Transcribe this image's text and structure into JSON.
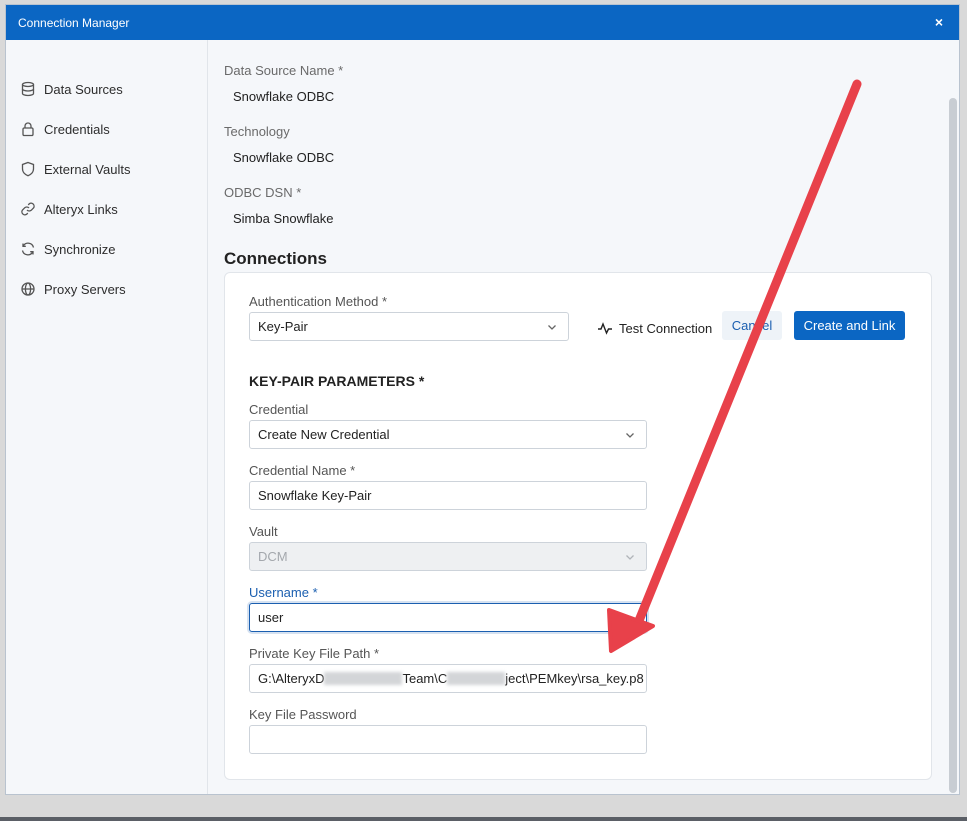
{
  "window": {
    "title": "Connection Manager",
    "close_glyph": "×"
  },
  "sidebar": {
    "items": [
      {
        "label": "Data Sources",
        "icon": "database-icon"
      },
      {
        "label": "Credentials",
        "icon": "lock-icon"
      },
      {
        "label": "External Vaults",
        "icon": "shield-icon"
      },
      {
        "label": "Alteryx Links",
        "icon": "link-icon"
      },
      {
        "label": "Synchronize",
        "icon": "sync-icon"
      },
      {
        "label": "Proxy Servers",
        "icon": "globe-icon"
      }
    ]
  },
  "details": {
    "data_source_name_label": "Data Source Name *",
    "data_source_name": "Snowflake ODBC",
    "technology_label": "Technology",
    "technology": "Snowflake ODBC",
    "odbc_dsn_label": "ODBC DSN *",
    "odbc_dsn": "Simba Snowflake"
  },
  "connections": {
    "title": "Connections",
    "auth_method_label": "Authentication Method *",
    "auth_method_value": "Key-Pair",
    "test_connection_label": "Test Connection",
    "cancel_label": "Cancel",
    "create_link_label": "Create and Link",
    "keypair_title": "KEY-PAIR PARAMETERS *",
    "credential_label": "Credential",
    "credential_value": "Create New Credential",
    "credential_name_label": "Credential Name *",
    "credential_name_value": "Snowflake Key-Pair",
    "vault_label": "Vault",
    "vault_value": "DCM",
    "username_label": "Username *",
    "username_value": "user",
    "private_key_label": "Private Key File Path *",
    "private_key_prefix": "G:\\AlteryxD",
    "private_key_middle": "Team\\C",
    "private_key_suffix": "ject\\PEMkey\\rsa_key.p8",
    "key_password_label": "Key File Password",
    "key_password_value": ""
  },
  "colors": {
    "accent": "#0b66c3",
    "annotation_arrow": "#e8414a"
  }
}
